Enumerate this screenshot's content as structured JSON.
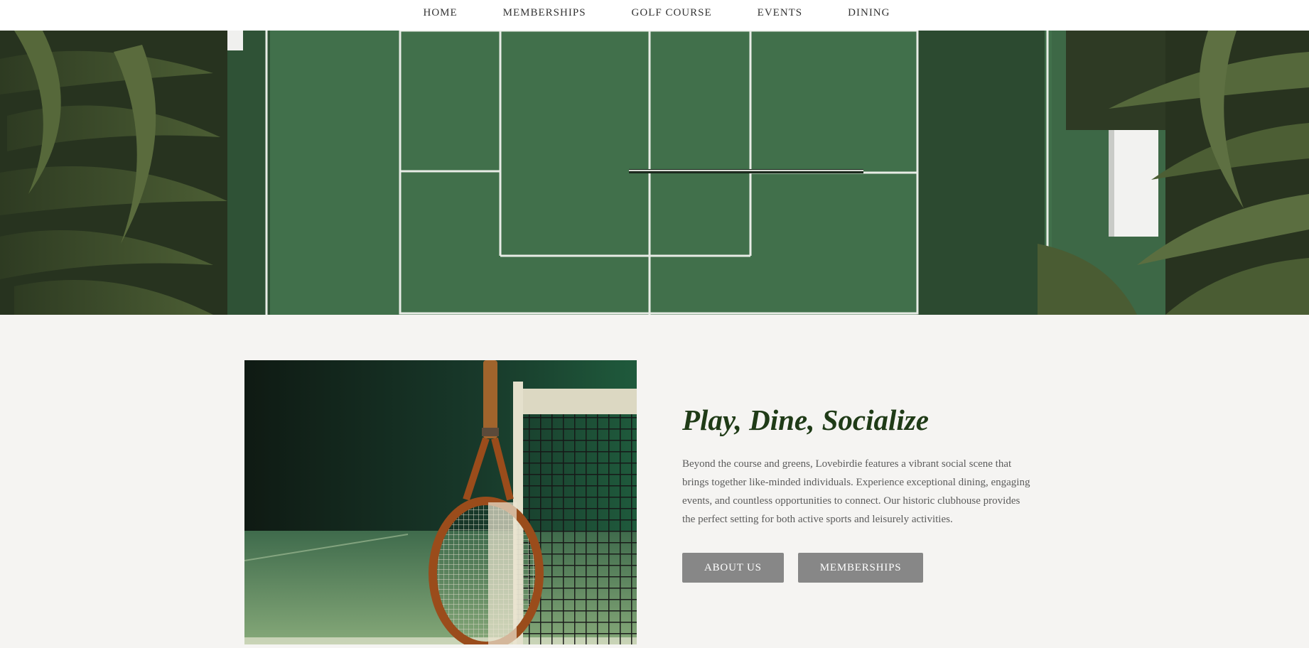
{
  "nav": {
    "items": [
      {
        "label": "HOME"
      },
      {
        "label": "MEMBERSHIPS"
      },
      {
        "label": "GOLF COURSE"
      },
      {
        "label": "EVENTS"
      },
      {
        "label": "DINING"
      }
    ]
  },
  "hero": {
    "image": "tennis-court-aerial-image"
  },
  "feature": {
    "image": "tennis-racket-net-image",
    "headline": "Play, Dine, Socialize",
    "body": "Beyond the course and greens, Lovebirdie features a vibrant social scene that brings together like-minded individuals. Experience exceptional dining, engaging events, and countless opportunities to connect. Our historic clubhouse provides the perfect setting for both active sports and leisurely activities.",
    "buttons": {
      "about": "ABOUT US",
      "memberships": "MEMBERSHIPS"
    }
  },
  "colors": {
    "background": "#f5f4f2",
    "headline": "#1f3b17",
    "button": "#878787",
    "court": "#3f6a48"
  }
}
